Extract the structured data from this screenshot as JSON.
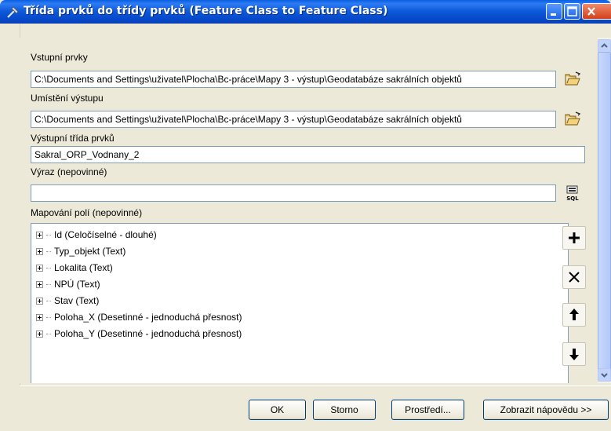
{
  "window": {
    "title": "Třída prvků do třídy prvků (Feature Class to Feature Class)"
  },
  "form": {
    "input_label": "Vstupní prvky",
    "input_value": "C:\\Documents and Settings\\uživatel\\Plocha\\Bc-práce\\Mapy 3 - výstup\\Geodatabáze sakrálních objektů",
    "output_location_label": "Umístění výstupu",
    "output_location_value": "C:\\Documents and Settings\\uživatel\\Plocha\\Bc-práce\\Mapy 3 - výstup\\Geodatabáze sakrálních objektů",
    "output_class_label": "Výstupní třída prvků",
    "output_class_value": "Sakral_ORP_Vodnany_2",
    "expression_label": "Výraz (nepovinné)",
    "expression_value": "",
    "sql_label": "SQL",
    "field_mapping_label": "Mapování polí (nepovinné)"
  },
  "fields": [
    {
      "label": "Id (Celočíselné - dlouhé)"
    },
    {
      "label": "Typ_objekt (Text)"
    },
    {
      "label": "Lokalita (Text)"
    },
    {
      "label": "NPÚ (Text)"
    },
    {
      "label": "Stav (Text)"
    },
    {
      "label": "Poloha_X (Desetinné - jednoduchá přesnost)"
    },
    {
      "label": "Poloha_Y (Desetinné - jednoduchá přesnost)"
    }
  ],
  "buttons": {
    "ok": "OK",
    "cancel": "Storno",
    "environments": "Prostředí...",
    "show_help": "Zobrazit nápovědu >>"
  },
  "icons": {
    "title": "hammer-tool-icon",
    "browse": "open-folder-icon",
    "sql": "sql-icon",
    "add": "plus-icon",
    "delete": "x-icon",
    "up": "arrow-up-icon",
    "down": "arrow-down-icon"
  }
}
